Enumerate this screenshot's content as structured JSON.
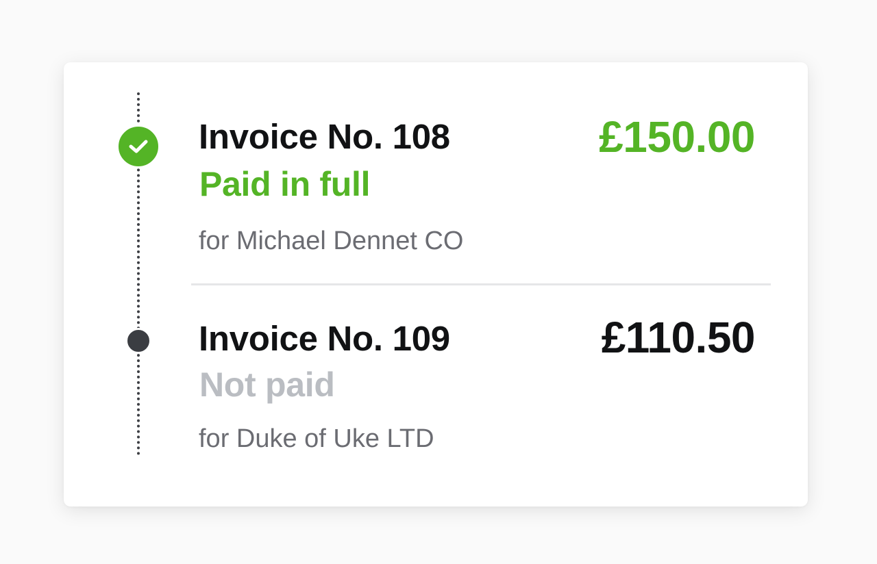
{
  "colors": {
    "paid": "#54b426",
    "not_paid": "#babdc2",
    "text_primary": "#111214",
    "text_secondary": "#6b6c72",
    "unpaid_marker": "#3b3d42"
  },
  "invoices": [
    {
      "title": "Invoice No. 108",
      "status": "Paid in full",
      "client": "for Michael Dennet CO",
      "amount": "£150.00",
      "marker_icon": "checkmark-icon"
    },
    {
      "title": "Invoice No. 109",
      "status": "Not paid",
      "client": "for Duke of Uke LTD",
      "amount": "£110.50",
      "marker_icon": "dot-icon"
    }
  ]
}
